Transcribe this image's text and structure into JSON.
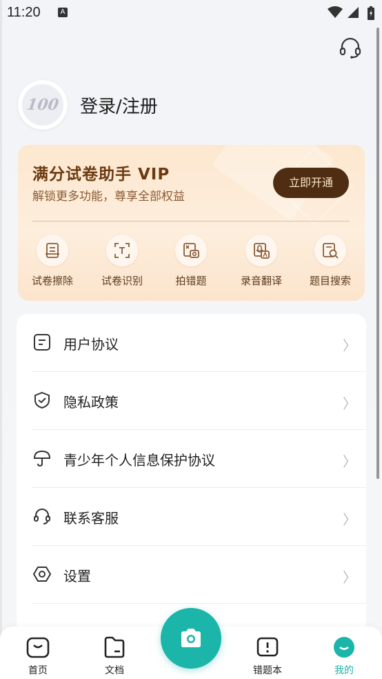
{
  "status_bar": {
    "time": "11:20",
    "notif_letter": "A"
  },
  "profile": {
    "avatar_text": "100",
    "login_label": "登录/注册"
  },
  "vip": {
    "title": "满分试卷助手 VIP",
    "subtitle": "解锁更多功能，尊享全部权益",
    "button": "立即开通",
    "features": [
      {
        "label": "试卷擦除",
        "icon": "paper-erase-icon"
      },
      {
        "label": "试卷识别",
        "icon": "scan-text-icon"
      },
      {
        "label": "拍错题",
        "icon": "photo-mistake-icon"
      },
      {
        "label": "录音翻译",
        "icon": "record-translate-icon"
      },
      {
        "label": "题目搜索",
        "icon": "question-search-icon"
      }
    ]
  },
  "menu": [
    {
      "label": "用户协议",
      "icon": "document-icon"
    },
    {
      "label": "隐私政策",
      "icon": "shield-check-icon"
    },
    {
      "label": "青少年个人信息保护协议",
      "icon": "umbrella-icon"
    },
    {
      "label": "联系客服",
      "icon": "headset-icon"
    },
    {
      "label": "设置",
      "icon": "settings-hexagon-icon"
    }
  ],
  "chevron": "〉",
  "nav": [
    {
      "label": "首页",
      "icon": "home-icon"
    },
    {
      "label": "文档",
      "icon": "document-folder-icon"
    },
    {
      "label": "错题本",
      "icon": "mistake-book-icon"
    },
    {
      "label": "我的",
      "icon": "profile-icon",
      "active": true
    }
  ],
  "colors": {
    "accent": "#1bb5a9",
    "vip_button": "#4e2d12",
    "vip_title": "#6b3a11"
  }
}
